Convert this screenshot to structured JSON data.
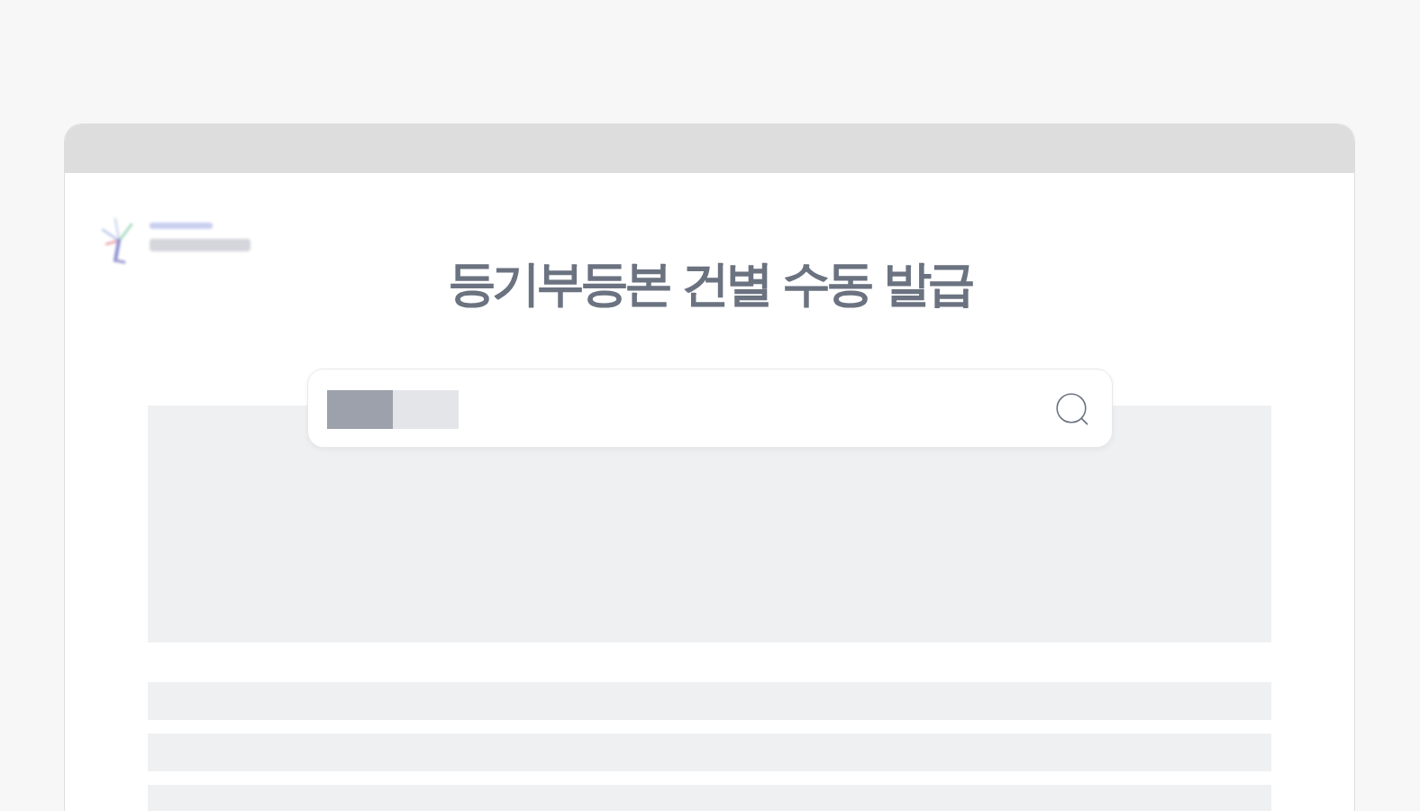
{
  "header": {
    "title": "등기부등본 건별 수동 발급"
  }
}
